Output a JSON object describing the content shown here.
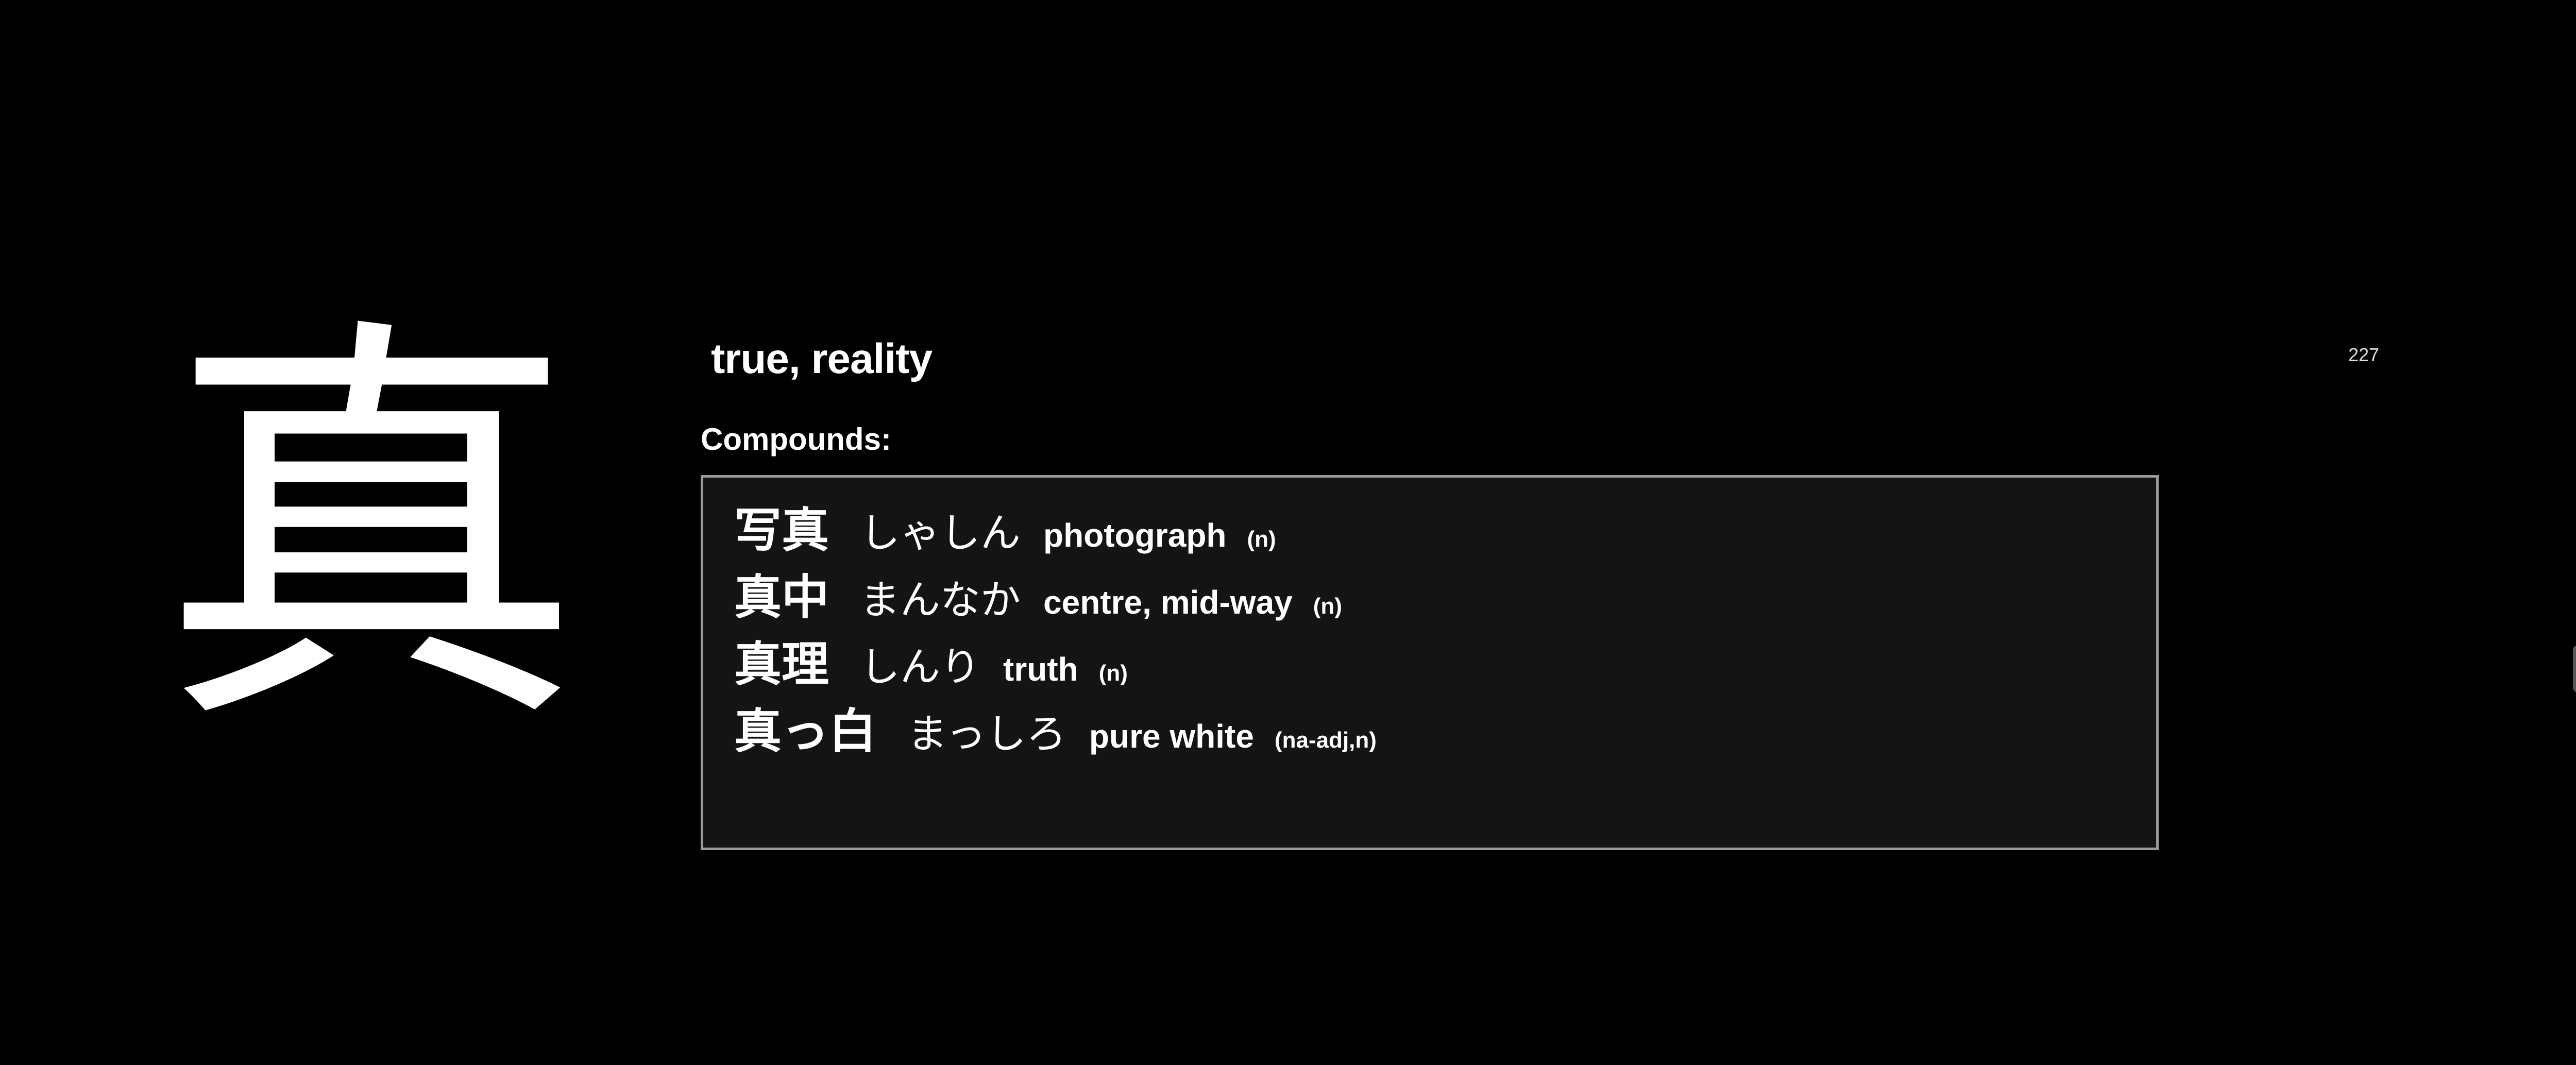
{
  "kanji": "真",
  "meaning": "true, reality",
  "frame_number": "227",
  "compounds_label": "Compounds:",
  "compounds": [
    {
      "word": "写真",
      "reading": "しゃしん",
      "meaning": "photograph",
      "pos": "(n)"
    },
    {
      "word": "真中",
      "reading": "まんなか",
      "meaning": "centre, mid-way",
      "pos": "(n)"
    },
    {
      "word": "真理",
      "reading": "しんり",
      "meaning": "truth",
      "pos": "(n)"
    },
    {
      "word": "真っ白",
      "reading": "まっしろ",
      "meaning": "pure white",
      "pos": "(na-adj,n)"
    }
  ],
  "colors": {
    "background": "#000000",
    "text": "#ffffff",
    "box_background": "#141414",
    "box_border": "#9a9a9a"
  }
}
